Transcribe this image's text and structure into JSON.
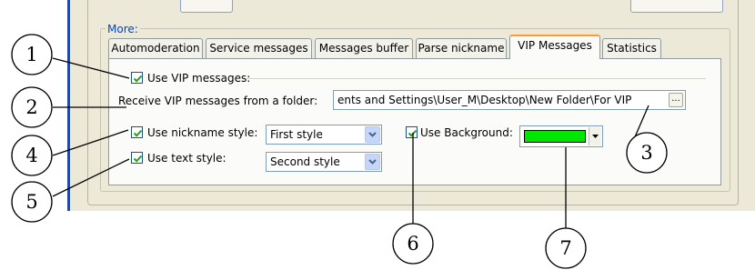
{
  "section": {
    "title": "More:"
  },
  "tabs": [
    {
      "label": "Automoderation",
      "active": false
    },
    {
      "label": "Service messages",
      "active": false
    },
    {
      "label": "Messages buffer",
      "active": false
    },
    {
      "label": "Parse nickname",
      "active": false
    },
    {
      "label": "VIP Messages",
      "active": true
    },
    {
      "label": "Statistics",
      "active": false
    }
  ],
  "vip": {
    "use_vip_label": "Use VIP messages:",
    "use_vip_checked": true,
    "folder_label": "Receive VIP messages from a folder:",
    "folder_value": "ents and Settings\\User_M\\Desktop\\New Folder\\For VIP",
    "browse_label": "...",
    "nickname_style_label": "Use nickname style:",
    "nickname_style_checked": true,
    "nickname_style_value": "First style",
    "text_style_label": "Use text style:",
    "text_style_checked": true,
    "text_style_value": "Second style",
    "background_label": "Use Background:",
    "background_checked": true,
    "background_color": "#00e600"
  },
  "callouts": [
    "1",
    "2",
    "3",
    "4",
    "5",
    "6",
    "7"
  ],
  "colors": {
    "accent_tab": "#ff9a2e",
    "more_label": "#0046d5",
    "window_bg": "#ece9d8"
  }
}
